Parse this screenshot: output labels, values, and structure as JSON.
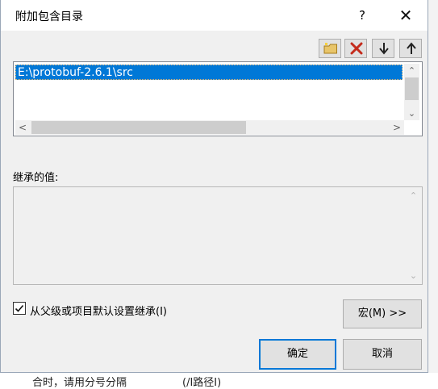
{
  "dialog": {
    "title": "附加包含目录",
    "help_label": "?",
    "close_label": "✕"
  },
  "toolbar": {
    "new_line_icon": "folder-new-icon",
    "delete_icon": "delete-x-icon",
    "move_down_icon": "arrow-down-icon",
    "move_up_icon": "arrow-up-icon"
  },
  "directories": {
    "items": [
      "E:\\protobuf-2.6.1\\src"
    ],
    "scroll_up": "⌃",
    "scroll_down": "⌄",
    "scroll_left": "<",
    "scroll_right": ">"
  },
  "inherited": {
    "label": "继承的值:",
    "scroll_up": "⌃",
    "scroll_down": "⌄"
  },
  "options": {
    "inherit_label": "从父级或项目默认设置继承(I)",
    "inherit_checked": true
  },
  "buttons": {
    "macro_label": "宏(M) >>",
    "ok_label": "确定",
    "cancel_label": "取消"
  },
  "background": {
    "left_fragments": [
      "—",
      "—"
    ],
    "right_fragments": [
      "—",
      "—",
      "—",
      "—"
    ],
    "bottom_text": "合时，请用分号分隔",
    "bottom_text2": "(/I路径I)"
  },
  "colors": {
    "selection": "#0078d7",
    "primary_border": "#0078d7",
    "delete_red": "#c42b1c"
  }
}
